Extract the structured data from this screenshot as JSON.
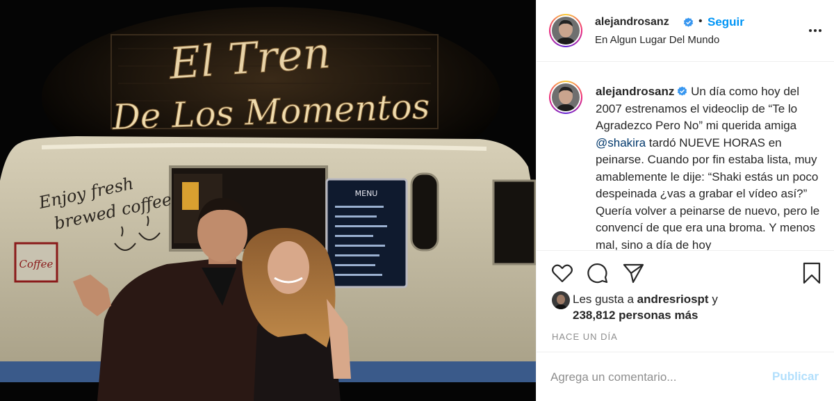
{
  "post": {
    "author": "alejandrosanz",
    "follow_label": "Seguir",
    "separator": "•",
    "location": "En Algun Lugar Del Mundo",
    "more_icon": "more-horizontal-icon"
  },
  "photo": {
    "sign_line1": "El Tren",
    "sign_line2": "De Los Momentos",
    "truck_text_line1": "Enjoy fresh",
    "truck_text_line2": "brewed coffee",
    "menu_title": "MENU",
    "side_sign": "Coffee"
  },
  "caption": {
    "author": "alejandrosanz",
    "text_before": "Un día como hoy del 2007 estrenamos el videoclip de “Te lo Agradezco Pero No” mi querida amiga ",
    "mention": "@shakira",
    "text_after": " tardó NUEVE HORAS en peinarse. Cuando por fin estaba lista, muy amablemente le dije: “Shaki estás un poco despeinada ¿vas a grabar el vídeo así?” Quería volver a peinarse de nuevo, pero le convencí de que era una broma. Y menos mal, sino a día de hoy"
  },
  "actions": {
    "like_icon": "heart-icon",
    "comment_icon": "comment-icon",
    "share_icon": "paper-plane-icon",
    "save_icon": "bookmark-icon"
  },
  "likes": {
    "prefix": "Les gusta a ",
    "user": "andresriospt",
    "conj": " y",
    "count": "238,812 personas más"
  },
  "timestamp": "HACE UN DÍA",
  "comment": {
    "placeholder": "Agrega un comentario...",
    "publish_label": "Publicar"
  },
  "colors": {
    "accent": "#0095f6",
    "publish_disabled": "#b2dffc",
    "muted": "#8e8e8e",
    "verified": "#3897f0"
  }
}
